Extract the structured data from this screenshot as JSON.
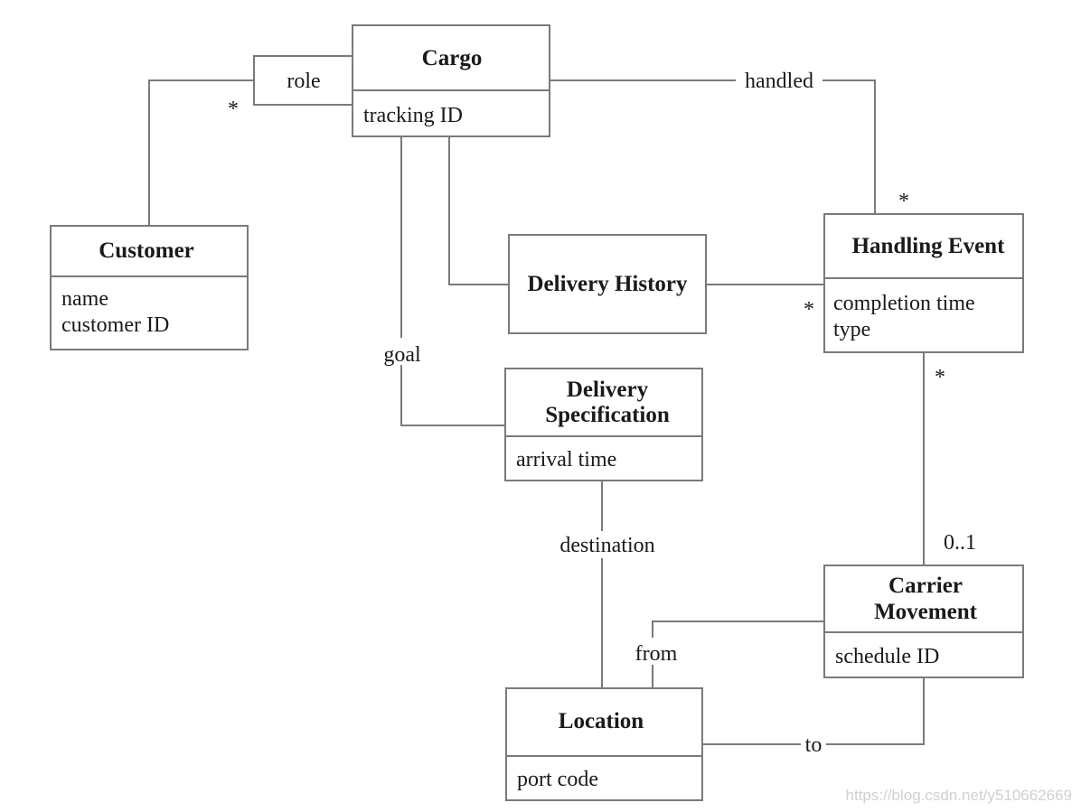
{
  "classes": {
    "cargo": {
      "name": "Cargo",
      "attributes": [
        "tracking ID"
      ]
    },
    "customer": {
      "name": "Customer",
      "attributes": [
        "name",
        "customer ID"
      ]
    },
    "delivery_history": {
      "name": "Delivery History"
    },
    "handling_event": {
      "name": "Handling Event",
      "attributes": [
        "completion time",
        "type"
      ]
    },
    "delivery_specification": {
      "name_lines": [
        "Delivery",
        "Specification"
      ],
      "attributes": [
        "arrival time"
      ]
    },
    "carrier_movement": {
      "name_lines": [
        "Carrier",
        "Movement"
      ],
      "attributes": [
        "schedule ID"
      ]
    },
    "location": {
      "name": "Location",
      "attributes": [
        "port code"
      ]
    }
  },
  "associations": {
    "role": "role",
    "role_multiplicity": "*",
    "handled": "handled",
    "handled_multiplicity": "*",
    "history_multiplicity": "*",
    "handling_to_carrier_multiplicity": "*",
    "carrier_multiplicity": "0..1",
    "goal": "goal",
    "destination": "destination",
    "from": "from",
    "to": "to"
  },
  "watermark": "https://blog.csdn.net/y510662669",
  "colors": {
    "line": "#7a7a7a",
    "text": "#1a1a1a"
  }
}
